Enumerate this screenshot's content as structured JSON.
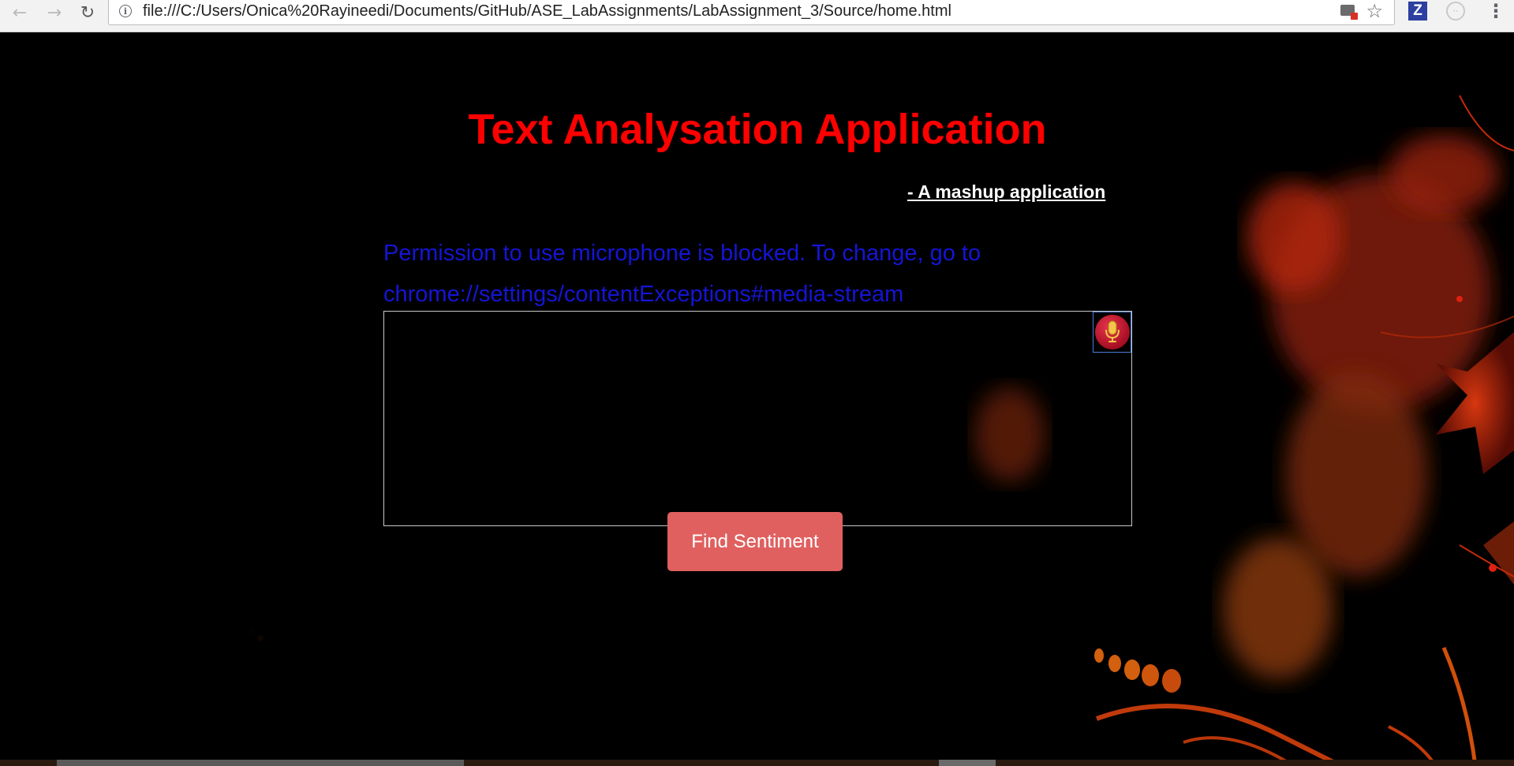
{
  "browser": {
    "url": "file:///C:/Users/Onica%20Rayineedi/Documents/GitHub/ASE_LabAssignments/LabAssignment_3/Source/home.html",
    "back_icon": "back-arrow-icon",
    "forward_icon": "forward-arrow-icon",
    "reload_icon": "reload-icon",
    "info_icon": "info-icon",
    "extension_label": "Z"
  },
  "page": {
    "title": "Text Analysation Application",
    "subtitle": "- A mashup application",
    "error_message": "Permission to use microphone is blocked. To change, go to chrome://settings/contentExceptions#media-stream",
    "text_input_value": "",
    "mic_icon": "microphone-icon",
    "find_button_label": "Find Sentiment"
  },
  "colors": {
    "title": "#ff0000",
    "subtitle": "#ffffff",
    "error": "#1515d6",
    "button": "#e06060",
    "background": "#000000"
  }
}
